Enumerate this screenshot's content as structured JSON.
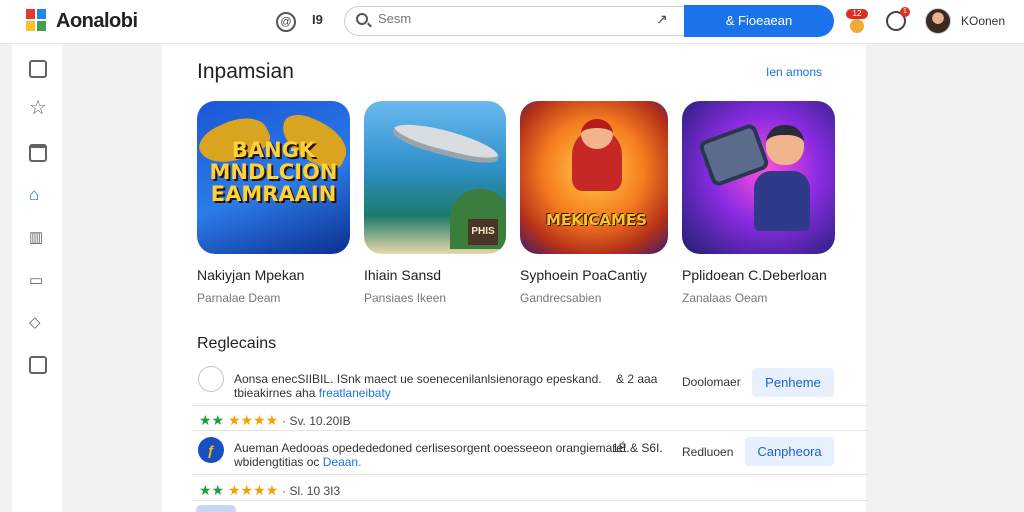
{
  "header": {
    "brand": "Aonalobi",
    "icon1_glyph": "@",
    "icon2_text": "I9",
    "search": {
      "placeholder": "Sesm",
      "clear_glyph": "↗",
      "button_label": "& Fioeaean"
    },
    "notification_badge": "12",
    "clock_badge": "1",
    "username": "KOonen"
  },
  "sidebar": {
    "items": [
      {
        "name": "library",
        "icon": "square-icon"
      },
      {
        "name": "favorites",
        "icon": "star-icon"
      },
      {
        "name": "collections",
        "icon": "frame-icon"
      },
      {
        "name": "home",
        "icon": "home-icon"
      },
      {
        "name": "stats",
        "icon": "chart-icon"
      },
      {
        "name": "tv",
        "icon": "tv-icon"
      },
      {
        "name": "tags",
        "icon": "tag-icon"
      },
      {
        "name": "reviews",
        "icon": "check-icon"
      }
    ]
  },
  "featured": {
    "title": "Inpamsian",
    "see_more": "Ien amons",
    "cards": [
      {
        "title": "Nakiyjan Mpekan",
        "subtitle": "Parnalae Deam",
        "art_text": "BANGK MNDLCION EAMRAAIN"
      },
      {
        "title": "Ihiain Sansd",
        "subtitle": "Pansiaes Ikeen",
        "art_text": "PHIS"
      },
      {
        "title": "Syphoein PoaCantiy",
        "subtitle": "Gandrecsabien",
        "art_text": "MEKICAMES"
      },
      {
        "title": "Pplidoean C.Deberloan",
        "subtitle": "Zanalaas Oeam",
        "art_text": ""
      }
    ]
  },
  "recommendations": {
    "title": "Reglecains",
    "rows": [
      {
        "line1": "Aonsa enecSIIBIL. ISnk maect ue soenecenilanlsienorago epeskand.",
        "line1_meta": "& 2 aaa",
        "line2_prefix": "tbieakirnes aha",
        "line2_link": "freatlaneibaty",
        "status": "Doolomaer",
        "button": "Penheme",
        "rating_text": "Sv. 10.20IB"
      },
      {
        "line1": "Aueman Aedooas opedededoned cerlisesorgent ooesseeon orangiemaret.",
        "line1_meta": "1É & S6I.",
        "line2_prefix": "wbidengtitias oc",
        "line2_link": "Deaan.",
        "status": "Redluoen",
        "button": "Canpheora",
        "rating_text": "Sl. 10 3I3"
      }
    ]
  },
  "colors": {
    "accent": "#1a73e8",
    "green": "#1e9e3a",
    "star": "#f4a100"
  }
}
